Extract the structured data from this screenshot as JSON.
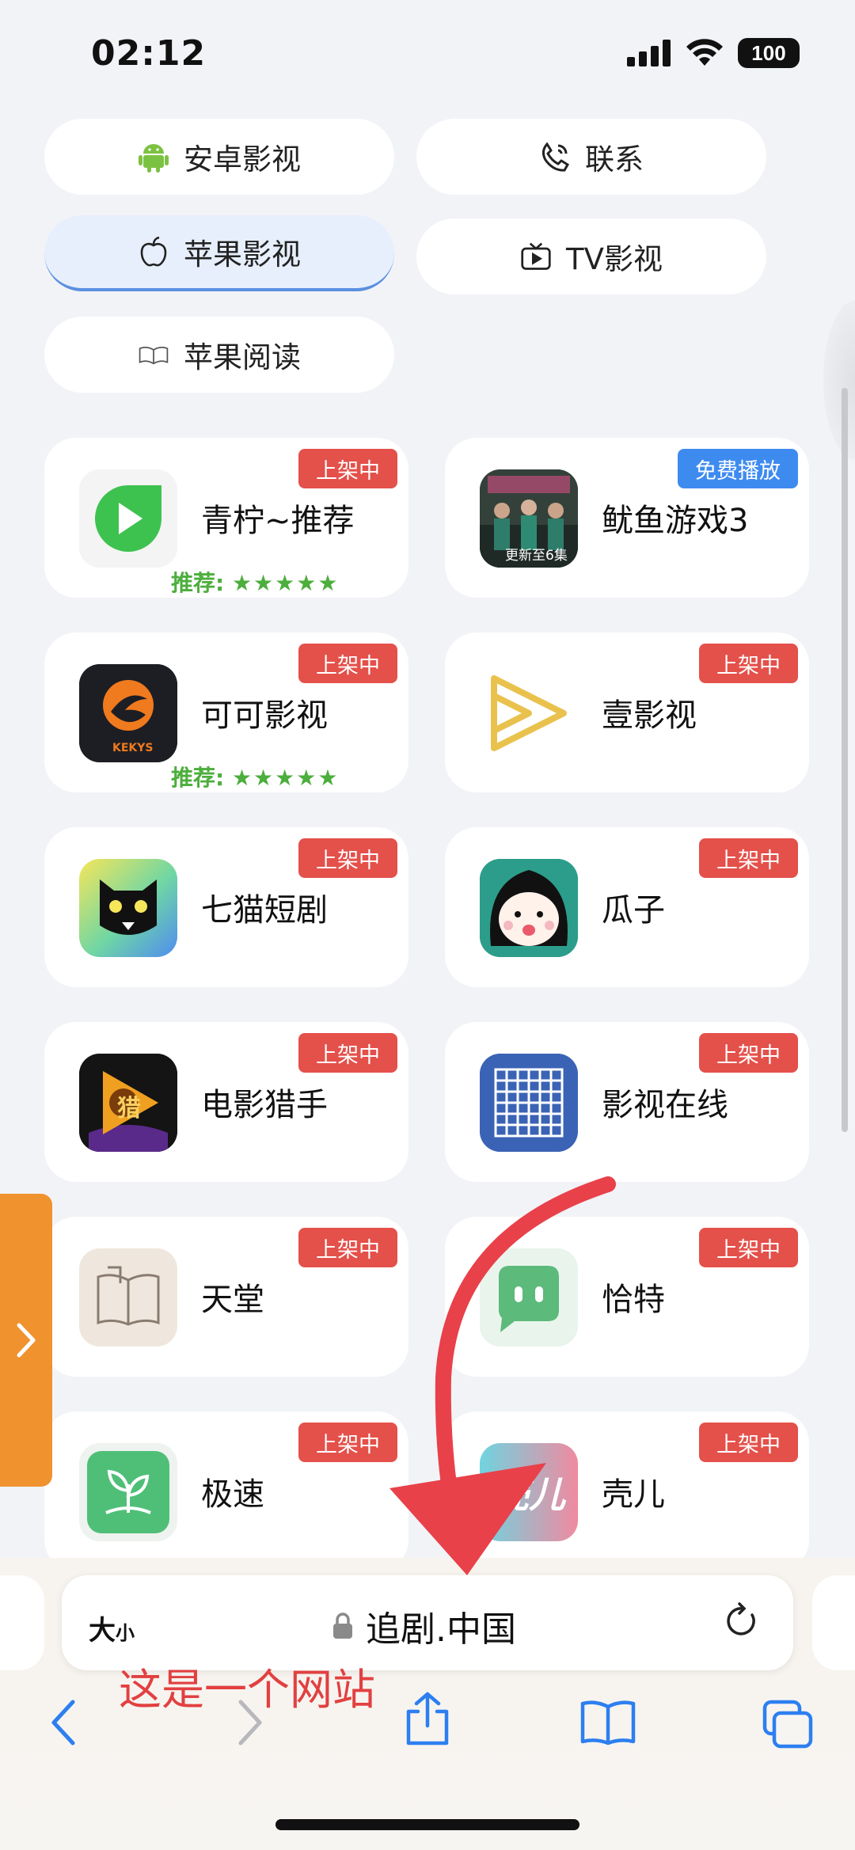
{
  "status_bar": {
    "time": "02:12",
    "battery": "100"
  },
  "nav_pills": [
    {
      "label": "安卓影视",
      "icon": "android-icon"
    },
    {
      "label": "联系",
      "icon": "phone-icon"
    },
    {
      "label": "苹果影视",
      "icon": "apple-icon",
      "active": true
    },
    {
      "label": "TV影视",
      "icon": "tv-icon"
    },
    {
      "label": "苹果阅读",
      "icon": "book-icon"
    }
  ],
  "apps": [
    {
      "name": "青柠~推荐",
      "badge": "上架中",
      "recommend": "推荐:",
      "stars": "★★★★★"
    },
    {
      "name": "鱿鱼游戏3",
      "badge": "免费播放",
      "poster_caption": "更新至6集"
    },
    {
      "name": "可可影视",
      "badge": "上架中",
      "recommend": "推荐:",
      "stars": "★★★★★",
      "icon_text": "KEKYS"
    },
    {
      "name": "壹影视",
      "badge": "上架中"
    },
    {
      "name": "七猫短剧",
      "badge": "上架中"
    },
    {
      "name": "瓜子",
      "badge": "上架中"
    },
    {
      "name": "电影猎手",
      "badge": "上架中",
      "icon_text": "猎"
    },
    {
      "name": "影视在线",
      "badge": "上架中"
    },
    {
      "name": "天堂",
      "badge": "上架中"
    },
    {
      "name": "恰特",
      "badge": "上架中"
    },
    {
      "name": "极速",
      "badge": "上架中"
    },
    {
      "name": "壳儿",
      "badge": "上架中",
      "icon_text": "壳儿"
    }
  ],
  "browser": {
    "size_label": "大",
    "size_label_small": "小",
    "url": "追剧.中国",
    "annotation": "这是一个网站"
  },
  "colors": {
    "badge_red": "#e4504a",
    "badge_blue": "#3e8bf0",
    "accent_blue": "#3d7bf0",
    "side_tab_orange": "#f0922e",
    "annotation_red": "#e24040"
  }
}
